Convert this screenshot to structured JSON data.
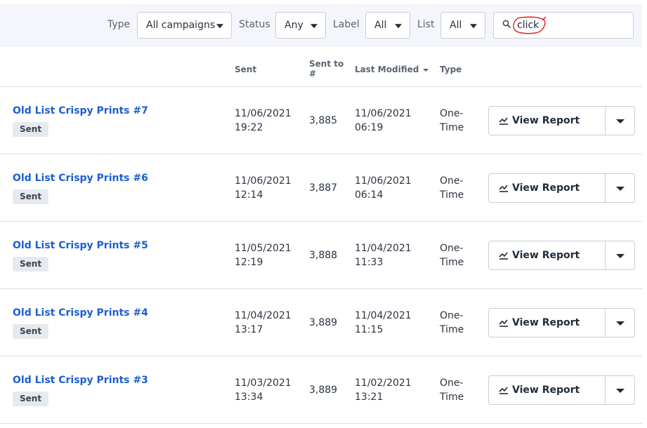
{
  "filters": {
    "type": {
      "label": "Type",
      "value": "All campaigns"
    },
    "status": {
      "label": "Status",
      "value": "Any"
    },
    "label": {
      "label": "Label",
      "value": "All"
    },
    "list": {
      "label": "List",
      "value": "All"
    },
    "search": {
      "value": "click",
      "icon": "search-icon",
      "annotation_color": "#e0201b"
    }
  },
  "columns": {
    "sent": "Sent",
    "sent_to_line1": "Sent to",
    "sent_to_line2": "#",
    "last_modified": "Last Modified",
    "type": "Type"
  },
  "rows": [
    {
      "name": "Old List Crispy Prints #7",
      "status": "Sent",
      "sent_date": "11/06/2021",
      "sent_time": "19:22",
      "sent_to": "3,885",
      "mod_date": "11/06/2021",
      "mod_time": "06:19",
      "type_line1": "One-",
      "type_line2": "Time",
      "action": "View Report"
    },
    {
      "name": "Old List Crispy Prints #6",
      "status": "Sent",
      "sent_date": "11/06/2021",
      "sent_time": "12:14",
      "sent_to": "3,887",
      "mod_date": "11/06/2021",
      "mod_time": "06:14",
      "type_line1": "One-",
      "type_line2": "Time",
      "action": "View Report"
    },
    {
      "name": "Old List Crispy Prints #5",
      "status": "Sent",
      "sent_date": "11/05/2021",
      "sent_time": "12:19",
      "sent_to": "3,888",
      "mod_date": "11/04/2021",
      "mod_time": "11:33",
      "type_line1": "One-",
      "type_line2": "Time",
      "action": "View Report"
    },
    {
      "name": "Old List Crispy Prints #4",
      "status": "Sent",
      "sent_date": "11/04/2021",
      "sent_time": "13:17",
      "sent_to": "3,889",
      "mod_date": "11/04/2021",
      "mod_time": "11:15",
      "type_line1": "One-",
      "type_line2": "Time",
      "action": "View Report"
    },
    {
      "name": "Old List Crispy Prints #3",
      "status": "Sent",
      "sent_date": "11/03/2021",
      "sent_time": "13:34",
      "sent_to": "3,889",
      "mod_date": "11/02/2021",
      "mod_time": "13:21",
      "type_line1": "One-",
      "type_line2": "Time",
      "action": "View Report"
    }
  ],
  "colors": {
    "link": "#1d5fd1",
    "badge_bg": "#e6e9ee",
    "filter_bar_bg": "#f4f6fb"
  }
}
